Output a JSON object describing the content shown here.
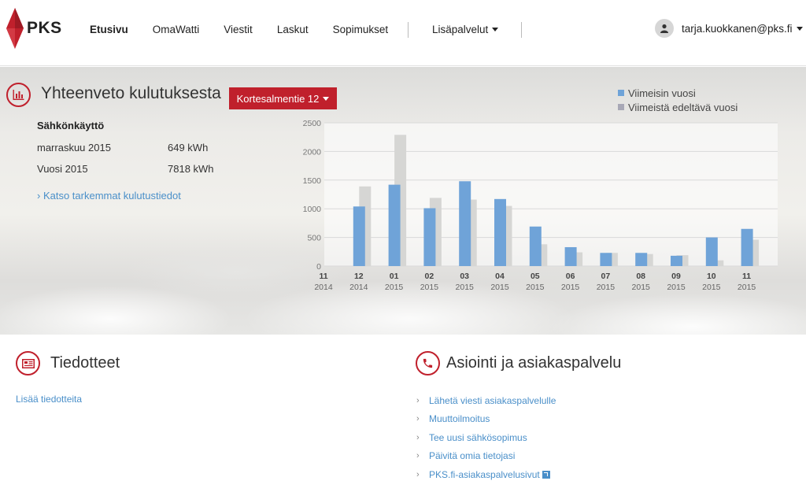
{
  "brand": {
    "name": "PKS",
    "accent": "#c0202c"
  },
  "nav": {
    "items": [
      "Etusivu",
      "OmaWatti",
      "Viestit",
      "Laskut",
      "Sopimukset"
    ],
    "more_label": "Lisäpalvelut",
    "user_email": "tarja.kuokkanen@pks.fi"
  },
  "hero": {
    "title": "Yhteenveto kulutuksesta",
    "period_button": "Kortesalmentie 12",
    "summary_heading": "Sähkönkäyttö",
    "rows": [
      {
        "label": "marraskuu 2015",
        "value": "649 kWh"
      },
      {
        "label": "Vuosi 2015",
        "value": "7818 kWh"
      }
    ],
    "details_link": "› Katso tarkemmat kulutustiedot"
  },
  "chart_data": {
    "type": "bar",
    "categories": [
      {
        "month": "11",
        "year": "2014"
      },
      {
        "month": "12",
        "year": "2014"
      },
      {
        "month": "01",
        "year": "2015"
      },
      {
        "month": "02",
        "year": "2015"
      },
      {
        "month": "03",
        "year": "2015"
      },
      {
        "month": "04",
        "year": "2015"
      },
      {
        "month": "05",
        "year": "2015"
      },
      {
        "month": "06",
        "year": "2015"
      },
      {
        "month": "07",
        "year": "2015"
      },
      {
        "month": "08",
        "year": "2015"
      },
      {
        "month": "09",
        "year": "2015"
      },
      {
        "month": "10",
        "year": "2015"
      },
      {
        "month": "11",
        "year": "2015"
      }
    ],
    "series": [
      {
        "name": "Viimeisin vuosi",
        "color": "#6fa3d8",
        "values": [
          0,
          1040,
          1420,
          1010,
          1480,
          1170,
          690,
          330,
          230,
          230,
          180,
          500,
          649
        ]
      },
      {
        "name": "Viimeistä edeltävä vuosi",
        "color": "#d6d6d4",
        "values": [
          0,
          1390,
          2290,
          1190,
          1160,
          1050,
          380,
          240,
          230,
          210,
          190,
          100,
          460
        ]
      }
    ],
    "y_ticks": [
      0,
      500,
      1000,
      1500,
      2000,
      2500
    ],
    "ylim": [
      0,
      2500
    ],
    "grid": true,
    "legend_position": "top-right"
  },
  "news": {
    "title": "Tiedotteet",
    "more_link": "Lisää tiedotteita"
  },
  "service": {
    "title": "Asiointi ja asiakaspalvelu",
    "links": [
      "Lähetä viesti asiakaspalvelulle",
      "Muuttoilmoitus",
      "Tee uusi sähkösopimus",
      "Päivitä omia tietojasi",
      "PKS.fi-asiakaspalvelusivut"
    ]
  }
}
